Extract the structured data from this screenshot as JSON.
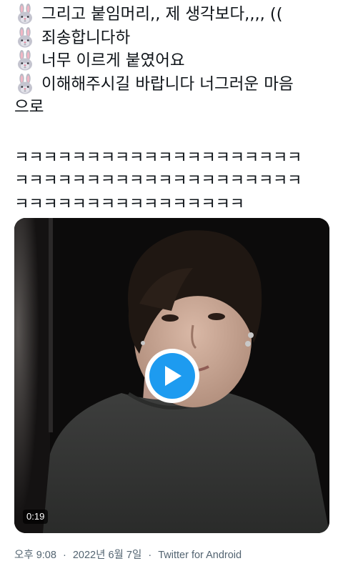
{
  "tweet": {
    "lines": [
      {
        "emoji": "rabbit",
        "text": "그리고 붙임머리,, 제 생각보다,,,, (("
      },
      {
        "emoji": "rabbit",
        "text": "죄송합니다하"
      },
      {
        "emoji": "rabbit",
        "text": "너무 이르게 붙였어요"
      },
      {
        "emoji": "rabbit",
        "text": "이해해주시길 바랍니다 너그러운 마음"
      },
      {
        "emoji": null,
        "text": "으로"
      }
    ],
    "laugh_lines": [
      "ㅋㅋㅋㅋㅋㅋㅋㅋㅋㅋㅋㅋㅋㅋㅋㅋㅋㅋㅋㅋ",
      "ㅋㅋㅋㅋㅋㅋㅋㅋㅋㅋㅋㅋㅋㅋㅋㅋㅋㅋㅋㅋ",
      "ㅋㅋㅋㅋㅋㅋㅋㅋㅋㅋㅋㅋㅋㅋㅋㅋ"
    ]
  },
  "media": {
    "type": "video",
    "duration": "0:19",
    "play_icon": "play-icon"
  },
  "meta": {
    "time": "오후 9:08",
    "separator": "·",
    "date": "2022년 6월 7일",
    "source": "Twitter for Android"
  },
  "colors": {
    "text": "#0f1419",
    "secondary": "#536471",
    "accent": "#1d9bf0"
  }
}
